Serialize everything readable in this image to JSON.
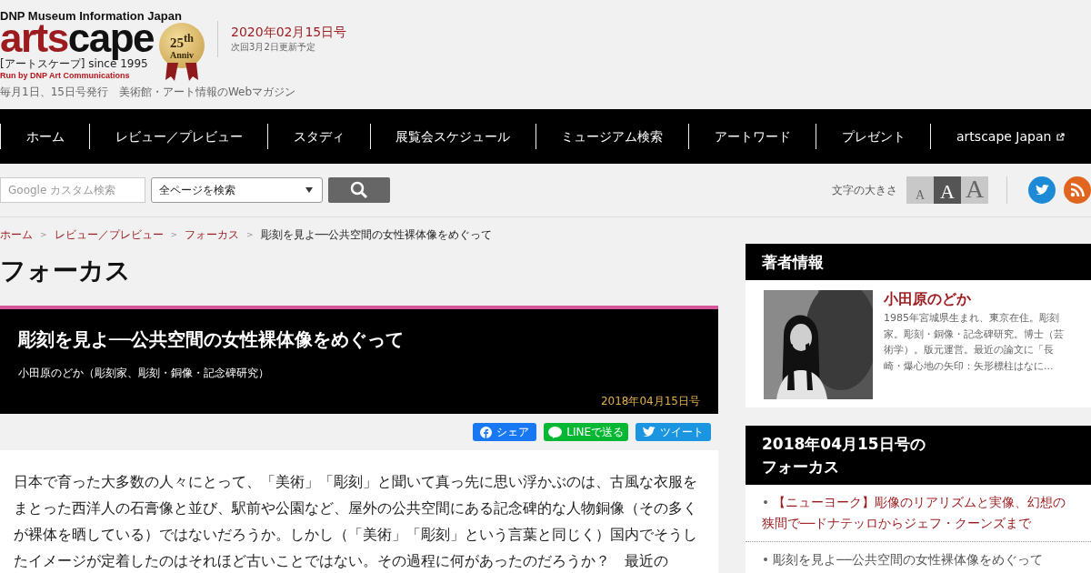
{
  "header": {
    "tagline_top": "DNP Museum Information Japan",
    "wordmark": [
      "arts",
      "cape"
    ],
    "subtitle": "[アートスケープ] since 1995",
    "run_by": "Run by DNP Art Communications",
    "badge_number": "25$^{th}$",
    "badge_label": "Anniv",
    "issue": "2020年02月15日号",
    "next_update": "次回3月2日更新予定",
    "description": "毎月1日、15日号発行　美術館・アート情報のWebマガジン"
  },
  "nav": [
    {
      "label": "ホーム",
      "external": false
    },
    {
      "label": "レビュー／プレビュー",
      "external": false
    },
    {
      "label": "スタディ",
      "external": false
    },
    {
      "label": "展覧会スケジュール",
      "external": false
    },
    {
      "label": "ミュージアム検索",
      "external": false
    },
    {
      "label": "アートワード",
      "external": false
    },
    {
      "label": "プレゼント",
      "external": false
    },
    {
      "label": "artscape Japan",
      "external": true
    }
  ],
  "search": {
    "placeholder": "Google カスタム検索",
    "scope": "全ページを検索"
  },
  "font_size": {
    "label": "文字の大きさ",
    "options": [
      {
        "label": "A",
        "selected": false
      },
      {
        "label": "A",
        "selected": true
      },
      {
        "label": "A",
        "selected": false
      }
    ]
  },
  "breadcrumb_separator": ">",
  "breadcrumb": [
    "ホーム",
    "レビュー／プレビュー",
    "フォーカス",
    "彫刻を見よ──公共空間の女性裸体像をめぐって"
  ],
  "section_title": "フォーカス",
  "article": {
    "title": "彫刻を見よ──公共空間の女性裸体像をめぐって",
    "author": "小田原のどか（彫刻家、彫刻・銅像・記念碑研究）",
    "date": "2018年04月15日号",
    "share": [
      "シェア",
      "LINEで送る",
      "ツイート"
    ],
    "body": "日本で育った大多数の人々にとって、「美術」「彫刻」と聞いて真っ先に思い浮かぶのは、古風な衣服をまとった西洋人の石膏像と並び、駅前や公園など、屋外の公共空間にある記念碑的な人物銅像（その多くが裸体を晒している）ではないだろうか。しかし（「美術」「彫刻」という言葉と同じく）国内でそうしたイメージが定着したのはそれほど古いことではない。その過程に何があったのだろうか？　最近の"
  },
  "author_box": {
    "heading": "著者情報",
    "name": "小田原のどか",
    "bio": "1985年宮城県生まれ、東京在住。彫刻家。彫刻・銅像・記念碑研究。博士（芸術学）。版元運営。最近の論文に「長崎・爆心地の矢印：矢形標柱はなに..."
  },
  "issue_box": {
    "heading": [
      "2018年04月15日号の",
      "フォーカス"
    ],
    "bullet": "•",
    "items": [
      {
        "title": "【ニューヨーク】彫像のリアリズムと実像、幻想の狭間で──ドナテッロからジェフ・クーンズまで",
        "selected": false
      },
      {
        "title": "彫刻を見よ──公共空間の女性裸体像をめぐって",
        "selected": true
      }
    ]
  }
}
